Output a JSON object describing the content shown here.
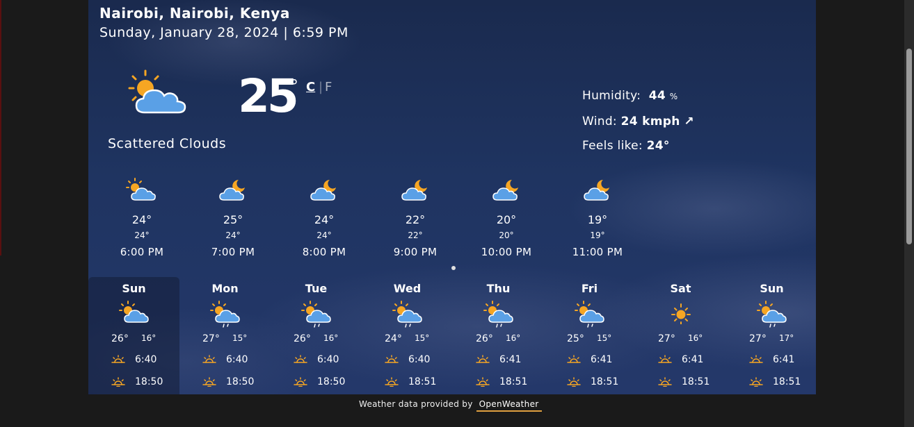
{
  "location": "Nairobi, Nairobi, Kenya",
  "datetime": "Sunday, January 28, 2024 | 6:59 PM",
  "current": {
    "icon": "sun-cloud-icon",
    "temp": "25",
    "deg": "°",
    "unit_c": "C",
    "unit_sep": "|",
    "unit_f": "F",
    "condition": "Scattered Clouds"
  },
  "details": {
    "humidity_label": "Humidity:",
    "humidity_value": "44",
    "humidity_unit": "%",
    "wind_label": "Wind:",
    "wind_value": "24 kmph",
    "wind_arrow": "↗",
    "feels_label": "Feels like:",
    "feels_value": "24°"
  },
  "hourly": [
    {
      "icon": "sun-cloud-icon",
      "temp": "24°",
      "feels": "24°",
      "time": "6:00 PM"
    },
    {
      "icon": "moon-cloud-icon",
      "temp": "25°",
      "feels": "24°",
      "time": "7:00 PM"
    },
    {
      "icon": "moon-cloud-icon",
      "temp": "24°",
      "feels": "24°",
      "time": "8:00 PM"
    },
    {
      "icon": "moon-cloud-icon",
      "temp": "22°",
      "feels": "22°",
      "time": "9:00 PM"
    },
    {
      "icon": "moon-cloud-icon",
      "temp": "20°",
      "feels": "20°",
      "time": "10:00 PM"
    },
    {
      "icon": "moon-cloud-icon",
      "temp": "19°",
      "feels": "19°",
      "time": "11:00 PM"
    }
  ],
  "daily": [
    {
      "day": "Sun",
      "icon": "sun-cloud-icon",
      "hi": "26°",
      "lo": "16°",
      "sunrise": "6:40",
      "sunset": "18:50"
    },
    {
      "day": "Mon",
      "icon": "sun-cloud-rain-icon",
      "hi": "27°",
      "lo": "15°",
      "sunrise": "6:40",
      "sunset": "18:50"
    },
    {
      "day": "Tue",
      "icon": "sun-cloud-rain-icon",
      "hi": "26°",
      "lo": "16°",
      "sunrise": "6:40",
      "sunset": "18:50"
    },
    {
      "day": "Wed",
      "icon": "sun-cloud-rain-icon",
      "hi": "24°",
      "lo": "15°",
      "sunrise": "6:40",
      "sunset": "18:51"
    },
    {
      "day": "Thu",
      "icon": "sun-cloud-rain-icon",
      "hi": "26°",
      "lo": "16°",
      "sunrise": "6:41",
      "sunset": "18:51"
    },
    {
      "day": "Fri",
      "icon": "sun-cloud-rain-icon",
      "hi": "25°",
      "lo": "15°",
      "sunrise": "6:41",
      "sunset": "18:51"
    },
    {
      "day": "Sat",
      "icon": "sun-icon",
      "hi": "27°",
      "lo": "16°",
      "sunrise": "6:41",
      "sunset": "18:51"
    },
    {
      "day": "Sun",
      "icon": "sun-cloud-rain-icon",
      "hi": "27°",
      "lo": "17°",
      "sunrise": "6:41",
      "sunset": "18:51"
    }
  ],
  "footer": {
    "text": "Weather data provided by",
    "link": "OpenWeather"
  },
  "colors": {
    "sun": "#f6a623",
    "cloud": "#5aa0e6",
    "link_underline": "#e0a040"
  }
}
